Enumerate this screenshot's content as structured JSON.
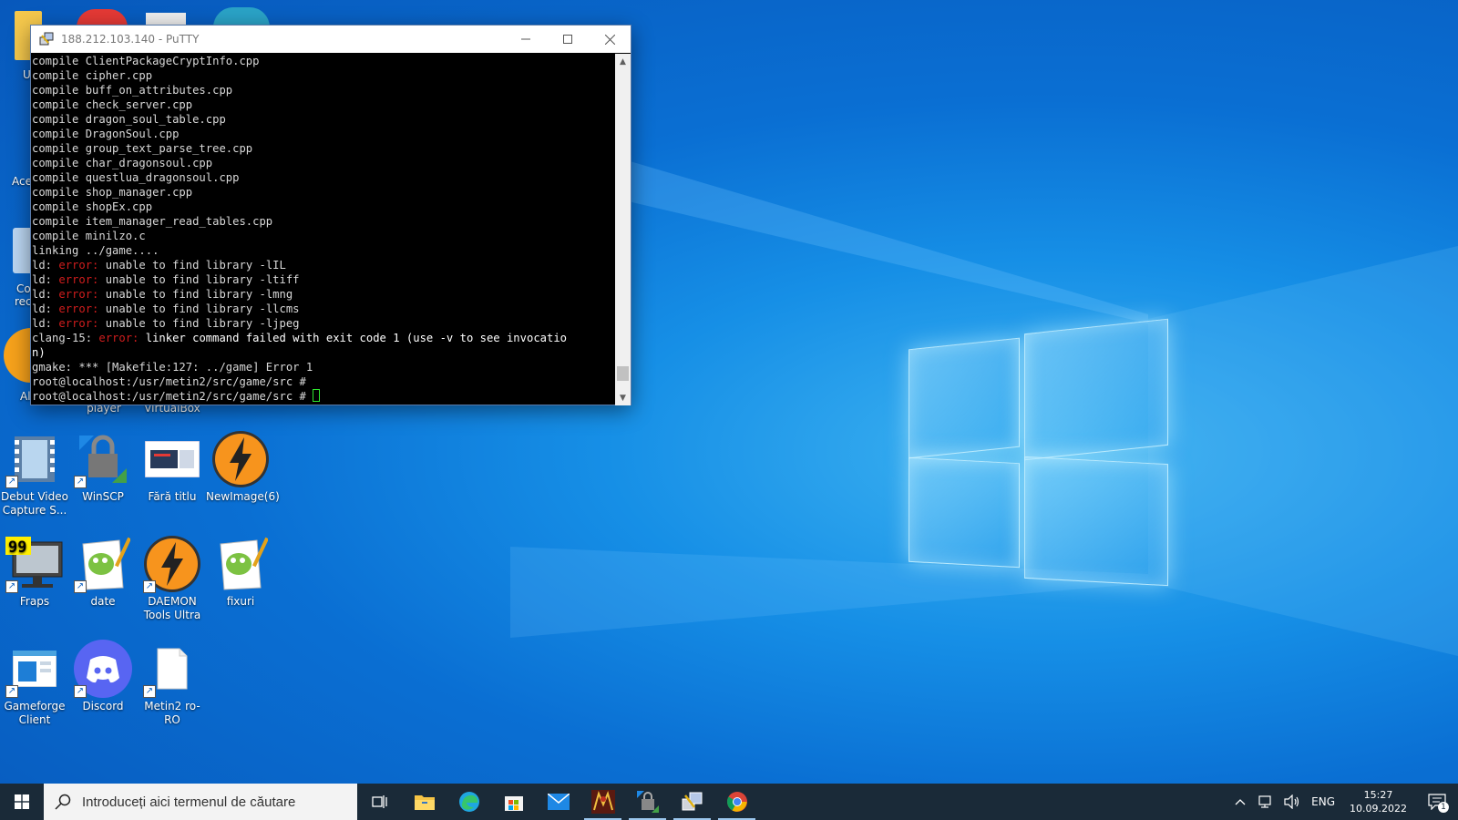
{
  "putty": {
    "title": "188.212.103.140 - PuTTY",
    "terminal_lines": [
      [
        {
          "t": "compile ClientPackageCryptInfo.cpp",
          "c": "n"
        }
      ],
      [
        {
          "t": "compile cipher.cpp",
          "c": "n"
        }
      ],
      [
        {
          "t": "compile buff_on_attributes.cpp",
          "c": "n"
        }
      ],
      [
        {
          "t": "compile check_server.cpp",
          "c": "n"
        }
      ],
      [
        {
          "t": "compile dragon_soul_table.cpp",
          "c": "n"
        }
      ],
      [
        {
          "t": "compile DragonSoul.cpp",
          "c": "n"
        }
      ],
      [
        {
          "t": "compile group_text_parse_tree.cpp",
          "c": "n"
        }
      ],
      [
        {
          "t": "compile char_dragonsoul.cpp",
          "c": "n"
        }
      ],
      [
        {
          "t": "compile questlua_dragonsoul.cpp",
          "c": "n"
        }
      ],
      [
        {
          "t": "compile shop_manager.cpp",
          "c": "n"
        }
      ],
      [
        {
          "t": "compile shopEx.cpp",
          "c": "n"
        }
      ],
      [
        {
          "t": "compile item_manager_read_tables.cpp",
          "c": "n"
        }
      ],
      [
        {
          "t": "compile minilzo.c",
          "c": "n"
        }
      ],
      [
        {
          "t": "linking ../game....",
          "c": "n"
        }
      ],
      [
        {
          "t": "ld: ",
          "c": "n"
        },
        {
          "t": "error:",
          "c": "e"
        },
        {
          "t": " unable to find library -lIL",
          "c": "n"
        }
      ],
      [
        {
          "t": "ld: ",
          "c": "n"
        },
        {
          "t": "error:",
          "c": "e"
        },
        {
          "t": " unable to find library -ltiff",
          "c": "n"
        }
      ],
      [
        {
          "t": "ld: ",
          "c": "n"
        },
        {
          "t": "error:",
          "c": "e"
        },
        {
          "t": " unable to find library -lmng",
          "c": "n"
        }
      ],
      [
        {
          "t": "ld: ",
          "c": "n"
        },
        {
          "t": "error:",
          "c": "e"
        },
        {
          "t": " unable to find library -llcms",
          "c": "n"
        }
      ],
      [
        {
          "t": "ld: ",
          "c": "n"
        },
        {
          "t": "error:",
          "c": "e"
        },
        {
          "t": " unable to find library -ljpeg",
          "c": "n"
        }
      ],
      [
        {
          "t": "clang-15: ",
          "c": "n"
        },
        {
          "t": "error:",
          "c": "e"
        },
        {
          "t": " linker command failed with exit code 1 (use -v to see invocatio",
          "c": "b"
        }
      ],
      [
        {
          "t": "n)",
          "c": "b"
        }
      ],
      [
        {
          "t": "gmake: *** [Makefile:127: ../game] Error 1",
          "c": "n"
        }
      ],
      [
        {
          "t": "root@localhost:/usr/metin2/src/game/src # ",
          "c": "n"
        }
      ],
      [
        {
          "t": "root@localhost:/usr/metin2/src/game/src # ",
          "c": "n"
        }
      ]
    ]
  },
  "desktop": {
    "partial_labels": [
      "U",
      "Ace",
      "Co",
      "rec",
      "Al"
    ],
    "icons": [
      {
        "label": "player",
        "icon": "media-player-icon"
      },
      {
        "label": "VirtualBox",
        "icon": "virtualbox-icon"
      },
      {
        "label": "Debut Video Capture S...",
        "icon": "video-capture-icon"
      },
      {
        "label": "WinSCP",
        "icon": "winscp-icon"
      },
      {
        "label": "Fără titlu",
        "icon": "screenshot-file-icon"
      },
      {
        "label": "NewImage(6)",
        "icon": "daemon-image-icon"
      },
      {
        "label": "Fraps",
        "icon": "fraps-icon"
      },
      {
        "label": "date",
        "icon": "notepad-plus-icon"
      },
      {
        "label": "DAEMON Tools Ultra",
        "icon": "daemon-tools-icon"
      },
      {
        "label": "fixuri",
        "icon": "notepad-plus-icon"
      },
      {
        "label": "Gameforge Client",
        "icon": "gameforge-icon"
      },
      {
        "label": "Discord",
        "icon": "discord-icon"
      },
      {
        "label": "Metin2 ro-RO",
        "icon": "blank-file-icon"
      }
    ]
  },
  "taskbar": {
    "search_placeholder": "Introduceți aici termenul de căutare",
    "apps": [
      "task-view-icon",
      "file-explorer-icon",
      "edge-icon",
      "store-icon",
      "mail-icon",
      "metin2-icon",
      "winscp-icon",
      "putty-icon",
      "chrome-icon"
    ],
    "language": "ENG",
    "time": "15:27",
    "date": "10.09.2022",
    "notification_count": "1"
  },
  "colors": {
    "terminal_bg": "#000000",
    "terminal_text": "#d9d9d9",
    "terminal_error": "#d11d1d",
    "cursor": "#2ee62e",
    "taskbar_bg": "#1a2a38"
  }
}
